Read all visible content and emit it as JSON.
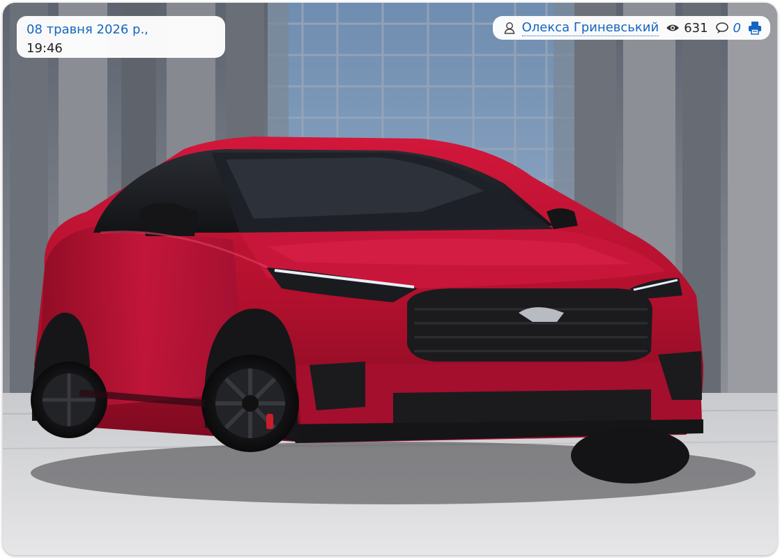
{
  "header": {
    "date": "08 травня 2026 р.,",
    "time": "19:46"
  },
  "meta": {
    "author": "Олекса Гриневський",
    "views": "631",
    "comments": "0"
  },
  "image": {
    "subject": "red-ford-mustang-mach-e"
  },
  "colors": {
    "link": "#1565c0",
    "car_red": "#b5122e",
    "print_icon": "#1565c0"
  },
  "icons": {
    "author": "user-icon",
    "views": "eye-icon",
    "comments": "comment-icon",
    "print": "print-icon"
  }
}
